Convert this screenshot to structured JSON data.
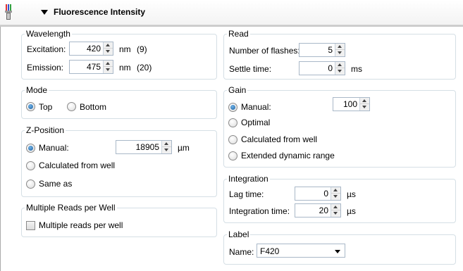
{
  "header": {
    "title": "Fluorescence Intensity"
  },
  "wavelength": {
    "legend": "Wavelength",
    "excitation_label": "Excitation:",
    "excitation_value": "420",
    "excitation_unit": "nm",
    "excitation_bw": "(9)",
    "emission_label": "Emission:",
    "emission_value": "475",
    "emission_unit": "nm",
    "emission_bw": "(20)"
  },
  "mode": {
    "legend": "Mode",
    "options": [
      "Top",
      "Bottom"
    ],
    "selected": "Top"
  },
  "zposition": {
    "legend": "Z-Position",
    "manual_label": "Manual:",
    "manual_value": "18905",
    "unit": "µm",
    "calc_label": "Calculated from well",
    "same_label": "Same as",
    "selected": "Manual"
  },
  "multiple": {
    "legend": "Multiple Reads per Well",
    "checkbox_label": "Multiple reads per well",
    "checked": false
  },
  "read": {
    "legend": "Read",
    "flashes_label": "Number of flashes:",
    "flashes_value": "5",
    "settle_label": "Settle time:",
    "settle_value": "0",
    "settle_unit": "ms"
  },
  "gain": {
    "legend": "Gain",
    "manual_label": "Manual:",
    "manual_value": "100",
    "optimal_label": "Optimal",
    "calc_label": "Calculated from well",
    "extended_label": "Extended dynamic range",
    "selected": "Manual"
  },
  "integration": {
    "legend": "Integration",
    "lag_label": "Lag time:",
    "lag_value": "0",
    "lag_unit": "µs",
    "int_label": "Integration time:",
    "int_value": "20",
    "int_unit": "µs"
  },
  "label": {
    "legend": "Label",
    "name_label": "Name:",
    "name_value": "F420"
  },
  "colors": {
    "group_border": "#d5dfe5",
    "radio_selected": "#1c5f9e",
    "input_border": "#a9b8c8"
  }
}
